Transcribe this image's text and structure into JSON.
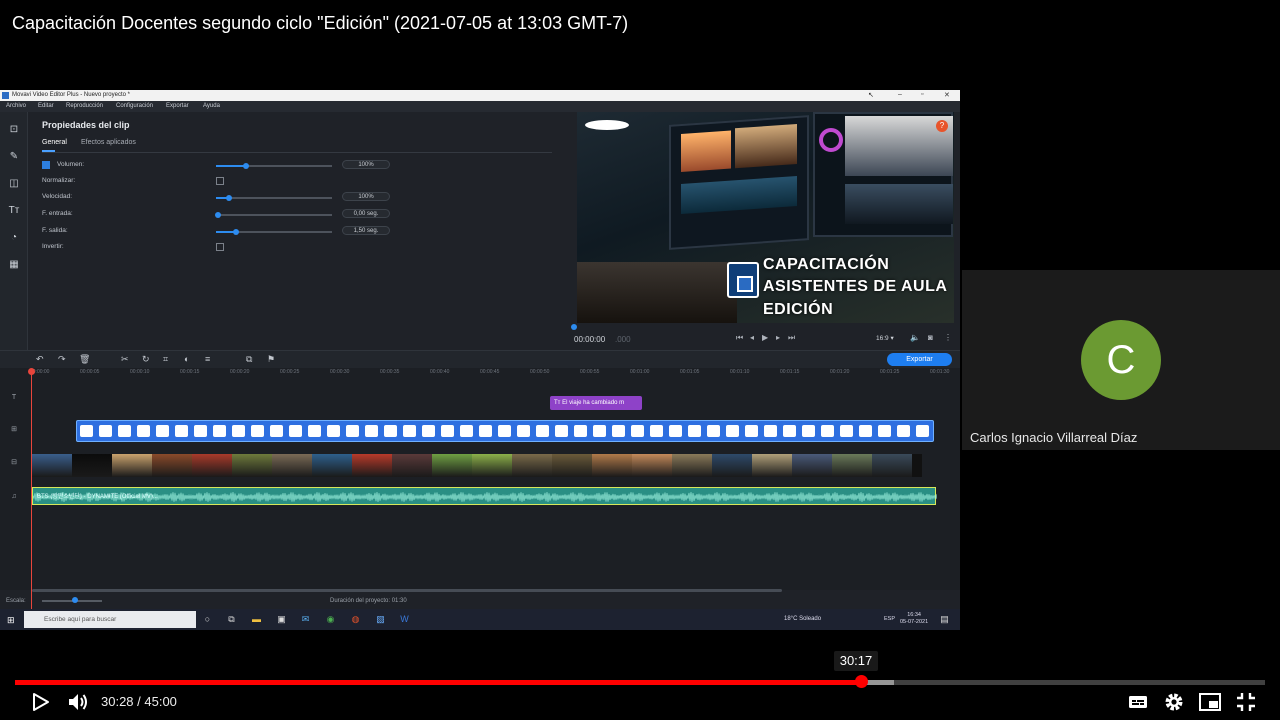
{
  "video": {
    "title": "Capacitación Docentes segundo ciclo \"Edición\" (2021-07-05 at 13:03 GMT-7)"
  },
  "participant": {
    "initial": "C",
    "name": "Carlos Ignacio Villarreal Díaz",
    "avatar_color": "#6b9a32"
  },
  "editor": {
    "window_title": "Movavi Video Editor Plus - Nuevo proyecto *",
    "menu": [
      "Archivo",
      "Editar",
      "Reproducción",
      "Configuración",
      "Exportar",
      "Ayuda"
    ],
    "toolrail_icons": [
      "import-icon",
      "magic-wand-icon",
      "transitions-icon",
      "titles-icon",
      "stickers-icon",
      "more-tools-icon"
    ],
    "properties": {
      "title": "Propiedades del clip",
      "tab_general": "General",
      "tab_effects": "Efectos aplicados",
      "rows": {
        "volume": {
          "label": "Volumen:",
          "value": "100%",
          "checked": true,
          "level": 0.26
        },
        "normalize": {
          "label": "Normalizar:",
          "checked": false
        },
        "speed": {
          "label": "Velocidad:",
          "value": "100%",
          "level": 0.11
        },
        "fade_in": {
          "label": "F. entrada:",
          "value": "0,00 seg.",
          "level": 0.02
        },
        "fade_out": {
          "label": "F. salida:",
          "value": "1,50 seg.",
          "level": 0.17
        },
        "invert": {
          "label": "Invertir:",
          "checked": false
        }
      }
    },
    "preview": {
      "caption_line1": "CAPACITACIÓN",
      "caption_line2": "ASISTENTES DE AULA",
      "caption_line3": "EDICIÓN",
      "time": "00:00:00",
      "time_ms": ".000",
      "aspect_ratio": "16:9 ▾",
      "help": "?"
    },
    "timeline": {
      "export_label": "Exportar",
      "ruler": [
        "00:00:00",
        "00:00:05",
        "00:00:10",
        "00:00:15",
        "00:00:20",
        "00:00:25",
        "00:00:30",
        "00:00:35",
        "00:00:40",
        "00:00:45",
        "00:00:50",
        "00:00:55",
        "00:01:00",
        "00:01:05",
        "00:01:10",
        "00:01:15",
        "00:01:20",
        "00:01:25",
        "00:01:30"
      ],
      "title_clip": "Tт El viaje ha cambiado m",
      "audio_clip": "BTS (방탄소년단) - DYNAMITE (Official MV)...",
      "scale_label": "Escala:",
      "duration_label": "Duración del proyecto:  01:30"
    },
    "taskbar": {
      "search_placeholder": "Escribe aquí para buscar",
      "weather": "18°C  Soleado",
      "lang": "ESP",
      "time": "16:34",
      "date": "05-07-2021"
    }
  },
  "player": {
    "tooltip_time": "30:17",
    "time_display": "30:28 / 45:00",
    "played_fraction": 0.677,
    "buffered_fraction": 0.703,
    "accent": "#ff0000"
  }
}
